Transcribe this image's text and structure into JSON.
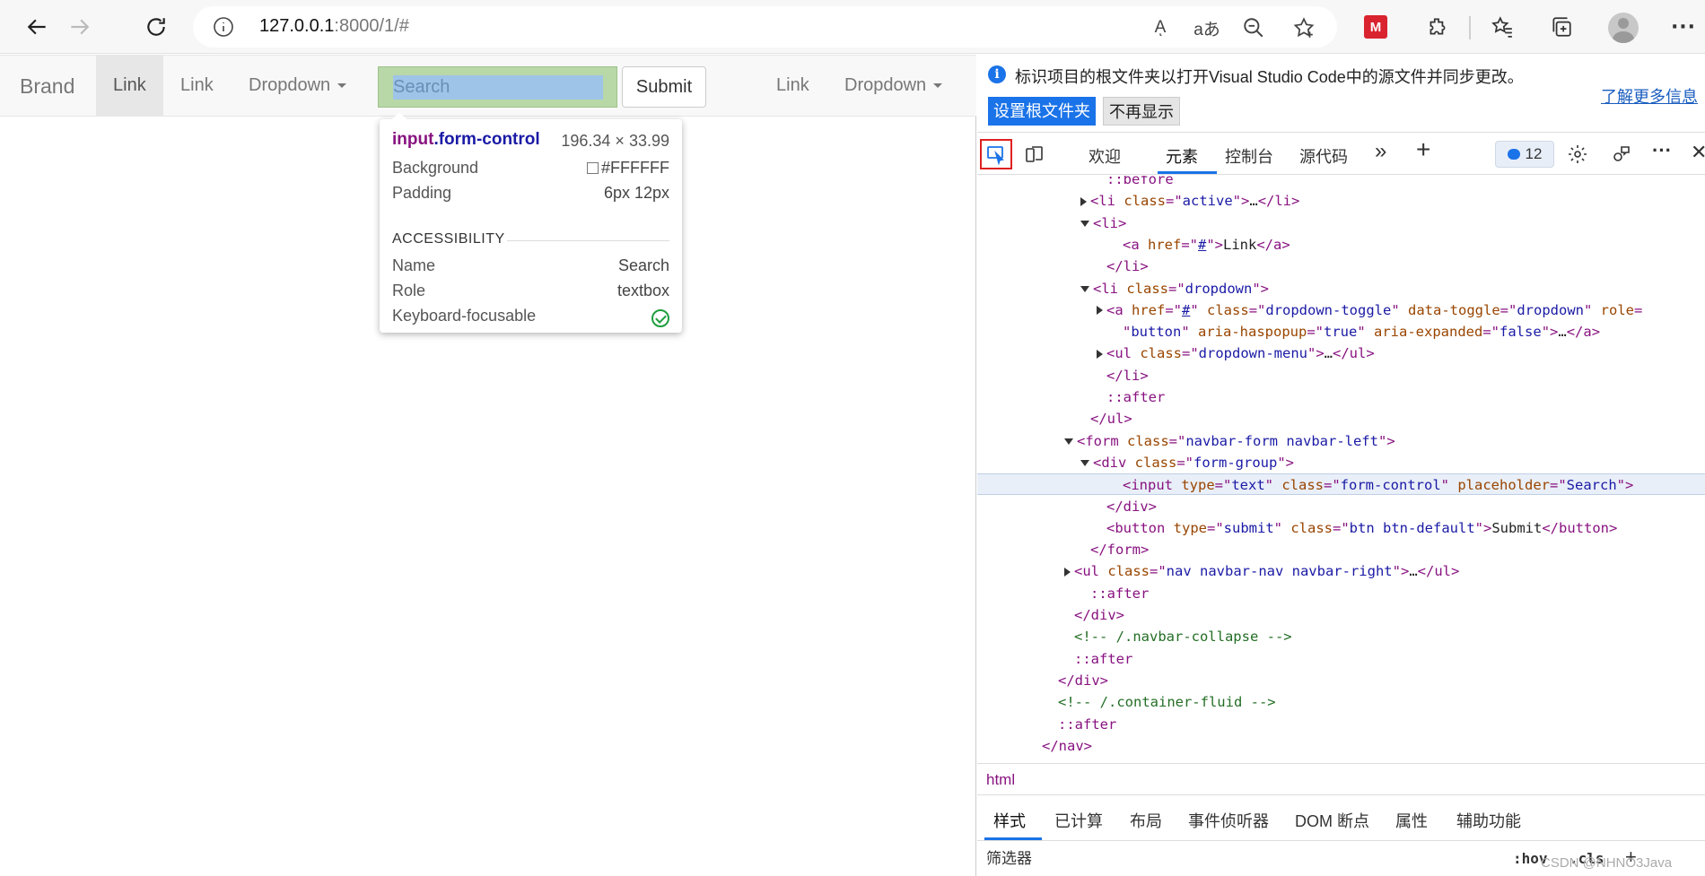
{
  "browser": {
    "url_host": "127.0.0.1",
    "url_rest": ":8000/1/#",
    "read_aloud_glyph": "Aͅ",
    "translate_glyph": "aあ"
  },
  "page": {
    "navbar": {
      "brand": "Brand",
      "link_active": "Link",
      "link_2": "Link",
      "dropdown_1": "Dropdown",
      "search_placeholder": "Search",
      "submit": "Submit",
      "link_right": "Link",
      "dropdown_right": "Dropdown"
    },
    "tooltip": {
      "tag": "input",
      "class": ".form-control",
      "dims": "196.34 × 33.99",
      "background_label": "Background",
      "background_value": "#FFFFFF",
      "padding_label": "Padding",
      "padding_value": "6px 12px",
      "accessibility_heading": "ACCESSIBILITY",
      "name_label": "Name",
      "name_value": "Search",
      "role_label": "Role",
      "role_value": "textbox",
      "focusable_label": "Keyboard-focusable"
    }
  },
  "devtools": {
    "infobar": {
      "message": "标识项目的根文件夹以打开Visual Studio Code中的源文件并同步更改。",
      "learn_more": "了解更多信息",
      "set_root": "设置根文件夹",
      "dont_show": "不再显示"
    },
    "tabs": {
      "welcome": "欢迎",
      "elements": "元素",
      "console": "控制台",
      "sources": "源代码",
      "more": "»",
      "add": "+",
      "issues_count": "12"
    },
    "dom_lines": [
      {
        "indent": 8,
        "tri": "",
        "html": "<span class=\"ps\">::before</span>"
      },
      {
        "indent": 7,
        "tri": "r",
        "html": "<span class=\"t\">&lt;li </span><span class=\"a\">class</span><span class=\"t\">=\"</span><span class=\"v\">active</span><span class=\"t\">\"&gt;</span><span class=\"tx\">…</span><span class=\"t\">&lt;/li&gt;</span>"
      },
      {
        "indent": 7,
        "tri": "d",
        "html": "<span class=\"t\">&lt;li&gt;</span>"
      },
      {
        "indent": 9,
        "tri": "",
        "html": "<span class=\"t\">&lt;a </span><span class=\"a\">href</span><span class=\"t\">=\"</span><span class=\"v u\">#</span><span class=\"t\">\"&gt;</span><span class=\"tx\">Link</span><span class=\"t\">&lt;/a&gt;</span>"
      },
      {
        "indent": 8,
        "tri": "",
        "html": "<span class=\"t\">&lt;/li&gt;</span>"
      },
      {
        "indent": 7,
        "tri": "d",
        "html": "<span class=\"t\">&lt;li </span><span class=\"a\">class</span><span class=\"t\">=\"</span><span class=\"v\">dropdown</span><span class=\"t\">\"&gt;</span>"
      },
      {
        "indent": 8,
        "tri": "r",
        "html": "<span class=\"t\">&lt;a </span><span class=\"a\">href</span><span class=\"t\">=\"</span><span class=\"v u\">#</span><span class=\"t\">\" </span><span class=\"a\">class</span><span class=\"t\">=\"</span><span class=\"v\">dropdown-toggle</span><span class=\"t\">\" </span><span class=\"a\">data-toggle</span><span class=\"t\">=\"</span><span class=\"v\">dropdown</span><span class=\"t\">\" </span><span class=\"a\">role</span><span class=\"t\">=</span>"
      },
      {
        "indent": 9,
        "tri": "",
        "html": "<span class=\"t\">\"</span><span class=\"v\">button</span><span class=\"t\">\" </span><span class=\"a\">aria-haspopup</span><span class=\"t\">=\"</span><span class=\"v\">true</span><span class=\"t\">\" </span><span class=\"a\">aria-expanded</span><span class=\"t\">=\"</span><span class=\"v\">false</span><span class=\"t\">\"&gt;</span><span class=\"tx\">…</span><span class=\"t\">&lt;/a&gt;</span>"
      },
      {
        "indent": 8,
        "tri": "r",
        "html": "<span class=\"t\">&lt;ul </span><span class=\"a\">class</span><span class=\"t\">=\"</span><span class=\"v\">dropdown-menu</span><span class=\"t\">\"&gt;</span><span class=\"tx\">…</span><span class=\"t\">&lt;/ul&gt;</span>"
      },
      {
        "indent": 8,
        "tri": "",
        "html": "<span class=\"t\">&lt;/li&gt;</span>"
      },
      {
        "indent": 8,
        "tri": "",
        "html": "<span class=\"ps\">::after</span>"
      },
      {
        "indent": 7,
        "tri": "",
        "html": "<span class=\"t\">&lt;/ul&gt;</span>"
      },
      {
        "indent": 6,
        "tri": "d",
        "html": "<span class=\"t\">&lt;form </span><span class=\"a\">class</span><span class=\"t\">=\"</span><span class=\"v\">navbar-form navbar-left</span><span class=\"t\">\"&gt;</span>"
      },
      {
        "indent": 7,
        "tri": "d",
        "html": "<span class=\"t\">&lt;div </span><span class=\"a\">class</span><span class=\"t\">=\"</span><span class=\"v\">form-group</span><span class=\"t\">\"&gt;</span>"
      },
      {
        "indent": 9,
        "tri": "",
        "sel": true,
        "html": "<span class=\"t\">&lt;input </span><span class=\"a\">type</span><span class=\"t\">=\"</span><span class=\"v\">text</span><span class=\"t\">\" </span><span class=\"a\">class</span><span class=\"t\">=\"</span><span class=\"v\">form-control</span><span class=\"t\">\" </span><span class=\"a\">placeholder</span><span class=\"t\">=\"</span><span class=\"v\">Search</span><span class=\"t\">\"&gt;</span>"
      },
      {
        "indent": 8,
        "tri": "",
        "html": "<span class=\"t\">&lt;/div&gt;</span>"
      },
      {
        "indent": 8,
        "tri": "",
        "html": "<span class=\"t\">&lt;button </span><span class=\"a\">type</span><span class=\"t\">=\"</span><span class=\"v\">submit</span><span class=\"t\">\" </span><span class=\"a\">class</span><span class=\"t\">=\"</span><span class=\"v\">btn btn-default</span><span class=\"t\">\"&gt;</span><span class=\"tx\">Submit</span><span class=\"t\">&lt;/button&gt;</span>"
      },
      {
        "indent": 7,
        "tri": "",
        "html": "<span class=\"t\">&lt;/form&gt;</span>"
      },
      {
        "indent": 6,
        "tri": "r",
        "html": "<span class=\"t\">&lt;ul </span><span class=\"a\">class</span><span class=\"t\">=\"</span><span class=\"v\">nav navbar-nav navbar-right</span><span class=\"t\">\"&gt;</span><span class=\"tx\">…</span><span class=\"t\">&lt;/ul&gt;</span>"
      },
      {
        "indent": 7,
        "tri": "",
        "html": "<span class=\"ps\">::after</span>"
      },
      {
        "indent": 6,
        "tri": "",
        "html": "<span class=\"t\">&lt;/div&gt;</span>"
      },
      {
        "indent": 6,
        "tri": "",
        "html": "<span class=\"c\">&lt;!-- /.navbar-collapse --&gt;</span>"
      },
      {
        "indent": 6,
        "tri": "",
        "html": "<span class=\"ps\">::after</span>"
      },
      {
        "indent": 5,
        "tri": "",
        "html": "<span class=\"t\">&lt;/div&gt;</span>"
      },
      {
        "indent": 5,
        "tri": "",
        "html": "<span class=\"c\">&lt;!-- /.container-fluid --&gt;</span>"
      },
      {
        "indent": 5,
        "tri": "",
        "html": "<span class=\"ps\">::after</span>"
      },
      {
        "indent": 4,
        "tri": "",
        "html": "<span class=\"t\">&lt;/nav&gt;</span>"
      }
    ],
    "breadcrumb": "html",
    "subtabs": {
      "styles": "样式",
      "computed": "已计算",
      "layout": "布局",
      "listeners": "事件侦听器",
      "dom_breakpoints": "DOM 断点",
      "properties": "属性",
      "accessibility": "辅助功能"
    },
    "filter": {
      "placeholder": "筛选器",
      "hov": ":hov",
      "cls": ".cls",
      "plus": "+"
    },
    "watermark": "CSDN @NHNO3Java"
  }
}
